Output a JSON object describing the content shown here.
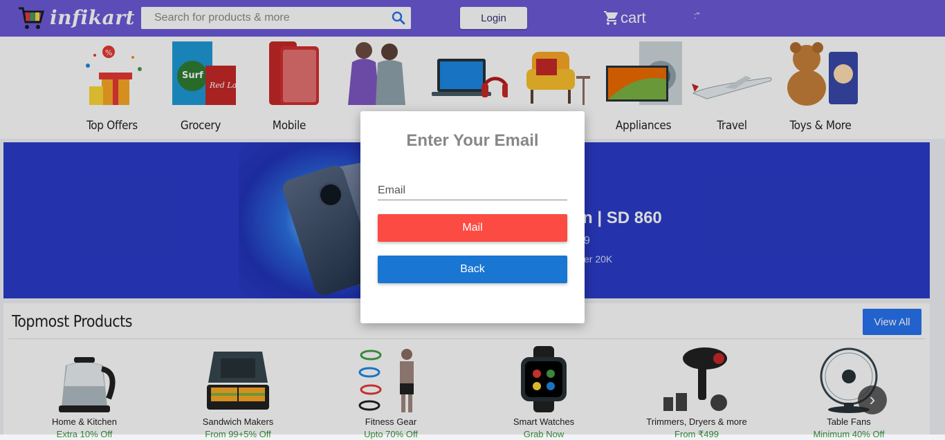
{
  "header": {
    "brand": "infikart",
    "search_placeholder": "Search for products & more",
    "login_label": "Login",
    "cart_label": "cart",
    "user_text": ":\""
  },
  "categories": [
    {
      "label": "Top Offers",
      "icon": "gift-icon"
    },
    {
      "label": "Grocery",
      "icon": "grocery-icon"
    },
    {
      "label": "Mobile",
      "icon": "mobile-icon"
    },
    {
      "label": "F",
      "icon": "fashion-icon"
    },
    {
      "label": "",
      "icon": "electronics-icon"
    },
    {
      "label": "",
      "icon": "furniture-icon"
    },
    {
      "label": "Appliances",
      "icon": "appliances-icon"
    },
    {
      "label": "Travel",
      "icon": "airplane-icon"
    },
    {
      "label": "Toys & More",
      "icon": "teddy-icon"
    }
  ],
  "banner": {
    "headline": "n | SD 860",
    "line1": "9",
    "line2": "er 20K"
  },
  "products": {
    "title": "Topmost Products",
    "view_all_label": "View All",
    "items": [
      {
        "name": "Home & Kitchen",
        "offer": "Extra 10% Off",
        "icon": "kettle-icon"
      },
      {
        "name": "Sandwich Makers",
        "offer": "From 99+5% Off",
        "icon": "sandwich-maker-icon"
      },
      {
        "name": "Fitness Gear",
        "offer": "Upto 70% Off",
        "icon": "fitness-icon"
      },
      {
        "name": "Smart Watches",
        "offer": "Grab Now",
        "icon": "smartwatch-icon"
      },
      {
        "name": "Trimmers, Dryers & more",
        "offer": "From ₹499",
        "icon": "hair-dryer-icon"
      },
      {
        "name": "Table Fans",
        "offer": "Minimum 40% Off",
        "icon": "fan-icon"
      }
    ],
    "next_arrow": "›"
  },
  "modal": {
    "title": "Enter Your Email",
    "email_placeholder": "Email",
    "mail_label": "Mail",
    "back_label": "Back"
  },
  "colors": {
    "header_bg": "#6c5ad8",
    "mail_button": "#fb4b43",
    "back_button": "#1976d2",
    "view_all": "#2874f0",
    "offer_text": "#388e3c"
  }
}
